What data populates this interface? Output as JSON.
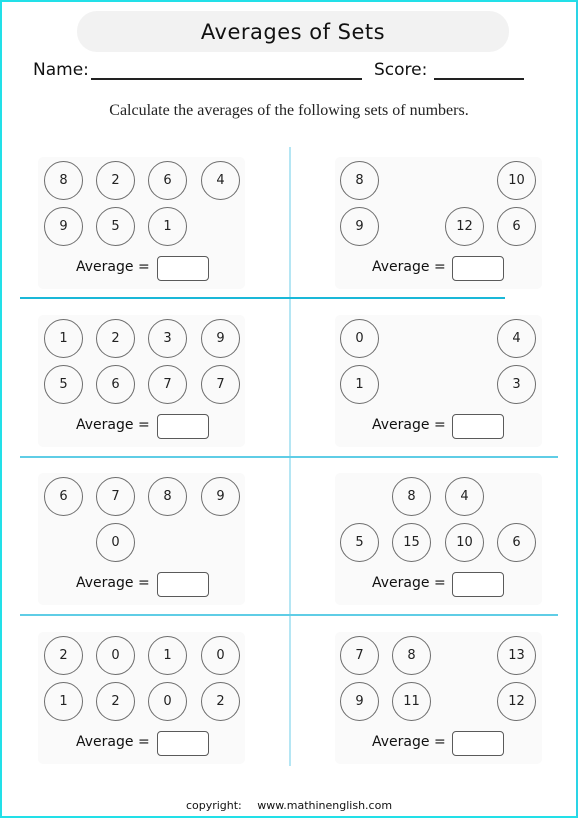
{
  "header": {
    "title": "Averages of Sets",
    "name_label": "Name:",
    "score_label": "Score:",
    "instructions": "Calculate the averages of the following sets of numbers."
  },
  "average_label": "Average =",
  "problems": [
    {
      "column": "left",
      "rows": [
        [
          8,
          2,
          6,
          4
        ],
        [
          9,
          5,
          1,
          null
        ]
      ]
    },
    {
      "column": "right",
      "rows": [
        [
          8,
          null,
          null,
          10
        ],
        [
          9,
          null,
          12,
          6
        ]
      ]
    },
    {
      "column": "left",
      "rows": [
        [
          1,
          2,
          3,
          9
        ],
        [
          5,
          6,
          7,
          7
        ]
      ]
    },
    {
      "column": "right",
      "rows": [
        [
          0,
          null,
          null,
          4
        ],
        [
          1,
          null,
          null,
          3
        ]
      ]
    },
    {
      "column": "left",
      "rows": [
        [
          6,
          7,
          8,
          9
        ],
        [
          null,
          0,
          null,
          null
        ]
      ]
    },
    {
      "column": "right",
      "rows": [
        [
          null,
          8,
          4,
          null
        ],
        [
          5,
          15,
          10,
          6
        ]
      ]
    },
    {
      "column": "left",
      "rows": [
        [
          2,
          0,
          1,
          0
        ],
        [
          1,
          2,
          0,
          2
        ]
      ]
    },
    {
      "column": "right",
      "rows": [
        [
          7,
          8,
          null,
          13
        ],
        [
          9,
          11,
          null,
          12
        ]
      ]
    }
  ],
  "footer": {
    "copyright_label": "copyright:",
    "website": "www.mathinenglish.com"
  },
  "colors": {
    "divider": "#1ab8d8",
    "frame": "#22e0e8"
  }
}
